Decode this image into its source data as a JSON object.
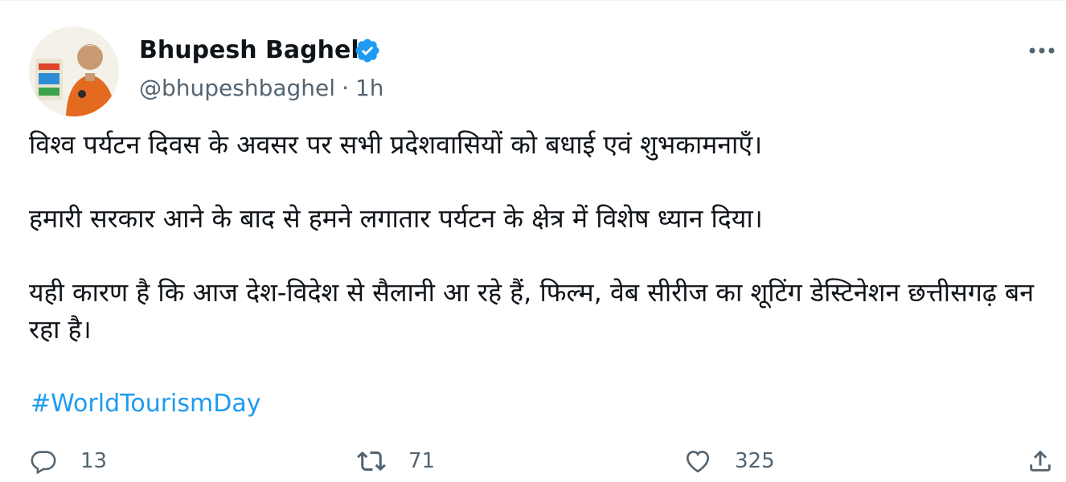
{
  "author": {
    "name": "Bhupesh Baghel",
    "handle": "@bhupeshbaghel",
    "separator": "·",
    "time": "1h"
  },
  "tweet": {
    "paragraphs": [
      "विश्व पर्यटन दिवस के अवसर पर सभी प्रदेशवासियों को बधाई एवं शुभकामनाएँ।",
      "हमारी सरकार आने के बाद से हमने लगातार पर्यटन के क्षेत्र में विशेष ध्यान दिया।",
      "यही कारण है कि आज देश-विदेश से सैलानी आ रहे हैं, फिल्म, वेब सीरीज का शूटिंग डेस्टिनेशन छत्तीसगढ़ बन रहा है।"
    ],
    "hashtag": "#WorldTourismDay"
  },
  "actions": {
    "replies": "13",
    "retweets": "71",
    "likes": "325"
  },
  "colors": {
    "text": "#0f1419",
    "secondary": "#536471",
    "link": "#1d9bf0",
    "verified": "#1d9bf0"
  },
  "icons": {
    "verified": "verified-badge-icon",
    "more": "more-dots-icon",
    "reply": "reply-icon",
    "retweet": "retweet-icon",
    "like": "heart-icon",
    "share": "share-icon"
  }
}
